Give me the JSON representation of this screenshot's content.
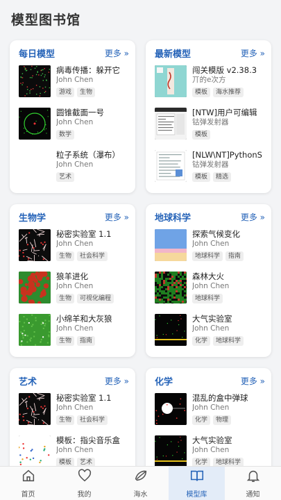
{
  "page_title": "模型图书馆",
  "more_label": "更多 »",
  "sections": [
    {
      "title": "每日模型",
      "items": [
        {
          "name": "病毒传播：躲开它",
          "author": "John Chen",
          "tags": [
            "游戏",
            "生物"
          ],
          "thumb": "virus"
        },
        {
          "name": "圆锥截面一号",
          "author": "John Chen",
          "tags": [
            "数学"
          ],
          "thumb": "circle"
        },
        {
          "name": "粒子系统（瀑布）",
          "author": "John Chen",
          "tags": [
            "艺术"
          ],
          "thumb": "blank"
        }
      ]
    },
    {
      "title": "最新模型",
      "items": [
        {
          "name": "闯关模版 v2.38.3",
          "author": "丌的e次方",
          "tags": [
            "模板",
            "海水推荐"
          ],
          "thumb": "maze"
        },
        {
          "name": "[NTW]用户可编辑",
          "author": "钴弹发射器",
          "tags": [
            "模板"
          ],
          "thumb": "editor"
        },
        {
          "name": "[NLW\\NT]PythonS",
          "author": "钴弹发射器",
          "tags": [
            "模板",
            "精选"
          ],
          "thumb": "python"
        }
      ]
    },
    {
      "title": "生物学",
      "items": [
        {
          "name": "秘密实验室 1.1",
          "author": "John Chen",
          "tags": [
            "生物",
            "社会科学"
          ],
          "thumb": "network"
        },
        {
          "name": "狼羊进化",
          "author": "John Chen",
          "tags": [
            "生物",
            "可视化编程"
          ],
          "thumb": "redgreen"
        },
        {
          "name": "小绵羊和大灰狼",
          "author": "John Chen",
          "tags": [
            "生物",
            "指南"
          ],
          "thumb": "grass"
        }
      ]
    },
    {
      "title": "地球科学",
      "items": [
        {
          "name": "探索气候变化",
          "author": "John Chen",
          "tags": [
            "地球科学",
            "指南"
          ],
          "thumb": "climate"
        },
        {
          "name": "森林大火",
          "author": "John Chen",
          "tags": [
            "地球科学"
          ],
          "thumb": "forest"
        },
        {
          "name": "大气实验室",
          "author": "John Chen",
          "tags": [
            "化学",
            "地球科学"
          ],
          "thumb": "atmos"
        }
      ]
    },
    {
      "title": "艺术",
      "items": [
        {
          "name": "秘密实验室 1.1",
          "author": "John Chen",
          "tags": [
            "生物",
            "社会科学"
          ],
          "thumb": "network"
        },
        {
          "name": "模板：指尖音乐盒",
          "author": "John Chen",
          "tags": [
            "模板",
            "艺术"
          ],
          "thumb": "music"
        }
      ]
    },
    {
      "title": "化学",
      "items": [
        {
          "name": "混乱的盒中弹球",
          "author": "John Chen",
          "tags": [
            "化学",
            "物理"
          ],
          "thumb": "balls"
        },
        {
          "name": "大气实验室",
          "author": "John Chen",
          "tags": [
            "化学",
            "地球科学"
          ],
          "thumb": "atmos"
        }
      ]
    }
  ],
  "tabs": [
    {
      "label": "首页",
      "icon": "home-icon",
      "active": false
    },
    {
      "label": "我的",
      "icon": "heart-icon",
      "active": false
    },
    {
      "label": "海水",
      "icon": "shell-icon",
      "active": false
    },
    {
      "label": "模型库",
      "icon": "book-icon",
      "active": true
    },
    {
      "label": "通知",
      "icon": "bell-icon",
      "active": false
    }
  ],
  "colors": {
    "accent": "#2563b8",
    "active_tab_bg": "#e3ecf8"
  }
}
